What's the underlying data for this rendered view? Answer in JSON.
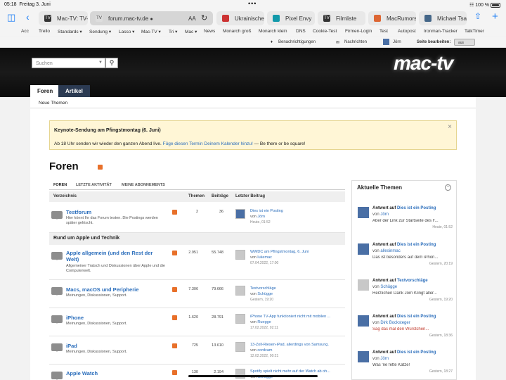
{
  "status": {
    "time": "05:18",
    "date": "Freitag 3. Juni",
    "dots": "•••",
    "battery": "100 %"
  },
  "tabs": [
    {
      "label": "Mac-TV: TV-I",
      "fav": "TV"
    },
    {
      "label": "forum.mac-tv.de",
      "fav": "TV",
      "lock": "🔒",
      "aa": "AA"
    },
    {
      "label": "Ukrainische I",
      "fav": ""
    },
    {
      "label": "Pixel Envy",
      "fav": ""
    },
    {
      "label": "Filmliste",
      "fav": "TV"
    },
    {
      "label": "MacRumors:",
      "fav": ""
    },
    {
      "label": "Michael Tsai",
      "fav": ""
    }
  ],
  "bookmarks": [
    "Acc",
    "Trello",
    "Standards ▾",
    "Sendung ▾",
    "Lasso ▾",
    "Mac-TV ▾",
    "Tri ▾",
    "Mac ▾",
    "News",
    "Monarch groß",
    "Monarch klein",
    "DNS",
    "Cookie-Test",
    "Firmen-Login",
    "Test",
    "Autopost",
    "Ironman-Tracker",
    "TalkTimer"
  ],
  "sitebar": {
    "notifications": "Benachrichtigungen",
    "messages": "Nachrichten",
    "user": "Jörn",
    "edit": "Seite bearbeiten:",
    "toggle": "aus"
  },
  "search": {
    "placeholder": "Suchen"
  },
  "logo": "mac-tv",
  "nav": {
    "tab1": "Foren",
    "tab2": "Artikel",
    "sub": "Neue Themen"
  },
  "notice": {
    "title": "Keynote-Sendung am Pfingstmontag (6. Juni)",
    "text_pre": "Ab 18 Uhr senden wir wieder den ganzen Abend live. ",
    "link": "Füge diesen Termin Deinem Kalender hinzu!",
    "text_post": " — Be there or be square!",
    "close": "×"
  },
  "heading": "Foren",
  "ftabs": [
    "FOREN",
    "LETZTE AKTIVITÄT",
    "MEINE ABONNEMENTS"
  ],
  "thead": {
    "dir": "Verzeichnis",
    "threads": "Themen",
    "posts": "Beiträge",
    "last": "Letzter Beitrag"
  },
  "category": "Rund um Apple und Technik",
  "forums": [
    {
      "title": "Testforum",
      "desc": "Hier könnt Ihr das Forum testen. Die Postings werden später gelöscht.",
      "threads": "2",
      "posts": "36",
      "last_title": "Dies ist ein Posting",
      "last_by": "Jörn",
      "last_date": "Heute, 01:52"
    },
    {
      "title": "Apple allgemein (und den Rest der Welt)",
      "desc": "Allgemeiner Tratsch und Diskussionen über Apple und die Computerwelt.",
      "threads": "2.951",
      "posts": "55.748",
      "last_title": "WWDC am Pfingstmontag, 6. Juni",
      "last_by": "lukemac",
      "last_date": "07.04.2022, 17:00"
    },
    {
      "title": "Macs, macOS und Peripherie",
      "desc": "Meinungen, Diskussionen, Support.",
      "threads": "7.306",
      "posts": "79.666",
      "last_title": "Textvorschläge",
      "last_by": "Schügge",
      "last_date": "Gestern, 19:20"
    },
    {
      "title": "iPhone",
      "desc": "Meinungen, Diskussionen, Support.",
      "threads": "1.620",
      "posts": "28.791",
      "last_title": "iPhone TV-App funktioniert nicht mit mobilen ...",
      "last_by": "Ruegge",
      "last_date": "17.02.2022, 02:11"
    },
    {
      "title": "iPad",
      "desc": "Meinungen, Diskussionen, Support.",
      "threads": "725",
      "posts": "13.610",
      "last_title": "13-Zoll-Riesen-iPad, allerdings von Samsung.",
      "last_by": "cordcam",
      "last_date": "12.02.2022, 00:21"
    },
    {
      "title": "Apple Watch",
      "desc": "",
      "threads": "130",
      "posts": "2.194",
      "last_title": "Spotify spielt nicht mehr auf der Watch ab oh...",
      "last_by": "Schügge",
      "last_date": ""
    }
  ],
  "side": {
    "title": "Aktuelle Themen",
    "answer_pre": "Antwort auf",
    "by": "von",
    "items": [
      {
        "thread": "Dies ist ein Posting",
        "user": "Jörn",
        "excerpt": "Aber der Link zur Startseite des F...",
        "date": "Heute, 01:52"
      },
      {
        "thread": "Dies ist ein Posting",
        "user": "allesinmac",
        "excerpt": "Das ist besonders auf dem iPhon...",
        "date": "Gestern, 20:19"
      },
      {
        "thread": "Textvorschläge",
        "user": "Schügge",
        "excerpt": "Herzlichen Dank Jörn Klingt aller...",
        "date": "Gestern, 19:20"
      },
      {
        "thread": "Dies ist ein Posting",
        "user": "Dirk Bocksteger",
        "excerpt": "Sag das mal den Würstchen...",
        "date": "Gestern, 18:36"
      },
      {
        "thread": "Dies ist ein Posting",
        "user": "Jörn",
        "excerpt": "Was 'ne fette Katze!",
        "date": "Gestern, 18:27"
      }
    ]
  }
}
